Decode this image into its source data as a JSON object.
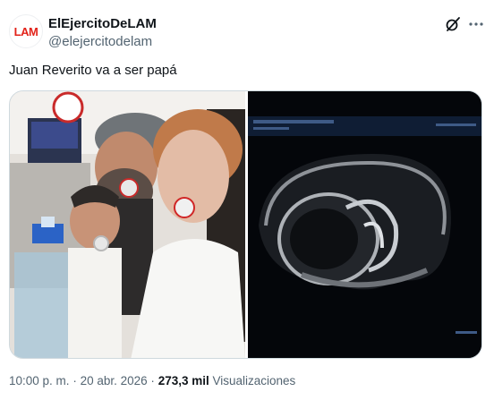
{
  "author": {
    "display_name": "ElEjercitoDeLAM",
    "handle": "@elejercitodelam",
    "avatar_text": "LAM"
  },
  "tweet": {
    "text": "Juan Reverito va a ser papá"
  },
  "media": {
    "left_image": "selfie photo of family with pacifiers",
    "right_image": "ultrasound scan"
  },
  "meta": {
    "time": "10:00 p. m.",
    "separator": "·",
    "date": "20 abr. 2026",
    "views_count": "273,3 mil",
    "views_label": "Visualizaciones"
  },
  "icons": {
    "grok": "grok-icon",
    "more": "more-icon"
  },
  "colors": {
    "brand_red": "#e2231a",
    "text_primary": "#0f1419",
    "text_secondary": "#536471"
  }
}
